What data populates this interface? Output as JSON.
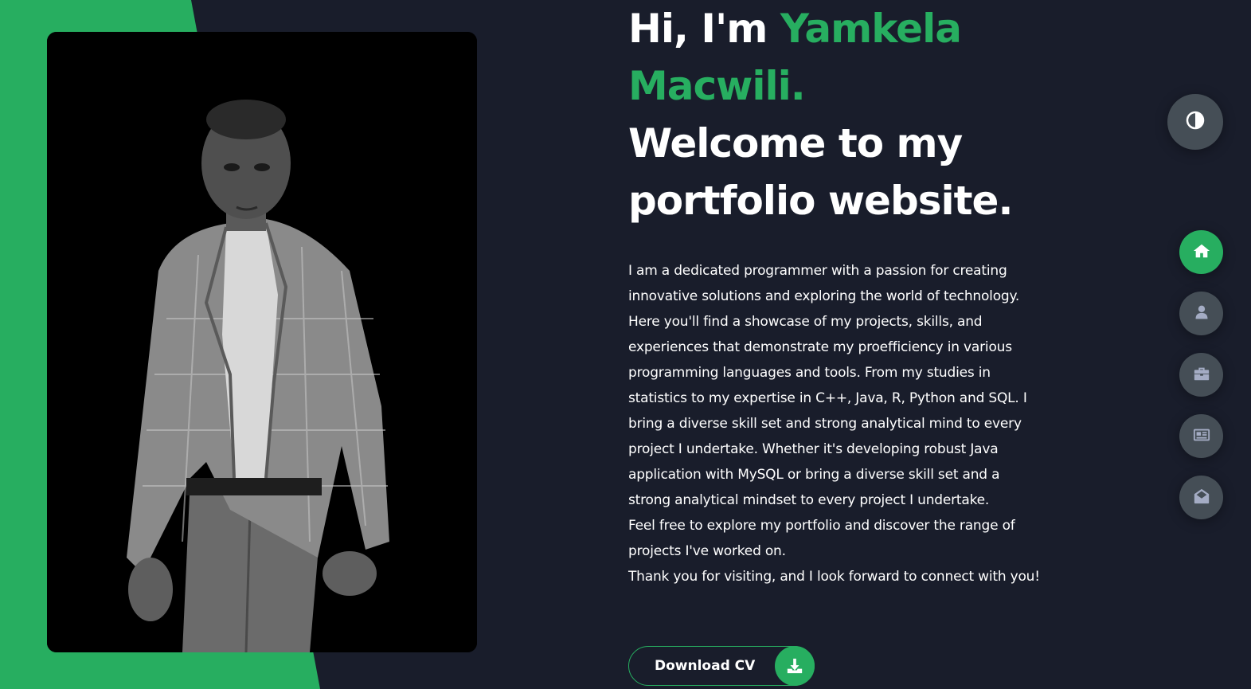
{
  "hero": {
    "greeting": "Hi, I'm ",
    "name_first": "Yamkela",
    "name_last": "Macwili.",
    "welcome_line1": "Welcome to my",
    "welcome_line2": "portfolio website."
  },
  "about": {
    "paragraph1": "I am a dedicated programmer with a passion for creating innovative solutions and exploring the world of technology. Here you'll find a showcase of my projects, skills, and experiences that demonstrate my proefficiency in various programming languages and tools. From my studies in statistics to my expertise in C++, Java, R, Python and SQL. I bring a diverse skill set and strong analytical mind to every project I undertake. Whether it's developing robust Java application with MySQL or bring a diverse skill set and a strong analytical mindset to every project I undertake.",
    "paragraph2": "Feel free to explore my portfolio and discover the range of projects I've worked on.",
    "paragraph3": "Thank you for visiting, and I look forward to connect with you!"
  },
  "download_button": {
    "label": "Download CV",
    "icon": "download-icon"
  },
  "theme_toggle": {
    "icon": "contrast-icon"
  },
  "side_nav": {
    "items": [
      {
        "icon": "home-icon",
        "active": true
      },
      {
        "icon": "user-icon",
        "active": false
      },
      {
        "icon": "briefcase-icon",
        "active": false
      },
      {
        "icon": "newspaper-icon",
        "active": false
      },
      {
        "icon": "envelope-open-icon",
        "active": false
      }
    ]
  },
  "colors": {
    "background": "#191d2b",
    "accent": "#27ae60",
    "nav_button": "#454e56",
    "text": "#ffffff",
    "icon_grey": "#a4acc4"
  }
}
